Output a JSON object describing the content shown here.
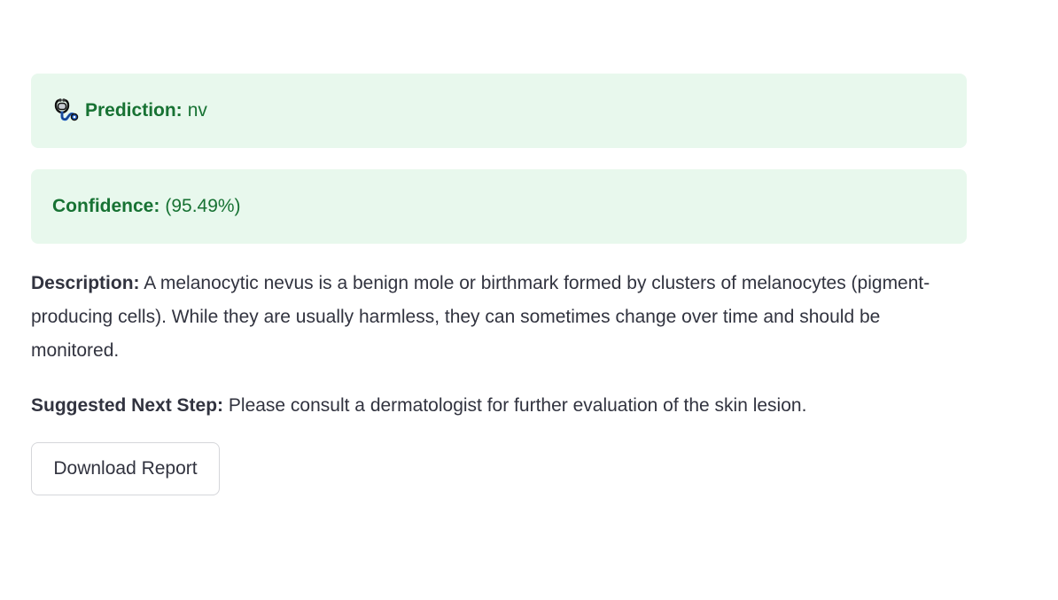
{
  "prediction": {
    "icon": "stethoscope-icon",
    "label": "Prediction:",
    "value": "nv"
  },
  "confidence": {
    "label": "Confidence:",
    "value": "(95.49%)"
  },
  "description": {
    "label": "Description:",
    "text": "A melanocytic nevus is a benign mole or birthmark formed by clusters of melanocytes (pigment-producing cells). While they are usually harmless, they can sometimes change over time and should be monitored."
  },
  "next_step": {
    "label": "Suggested Next Step:",
    "text": "Please consult a dermatologist for further evaluation of the skin lesion."
  },
  "download_button": {
    "label": "Download Report"
  },
  "colors": {
    "alert_background": "#e8f8ed",
    "alert_text": "#177233",
    "body_text": "#31333f"
  }
}
